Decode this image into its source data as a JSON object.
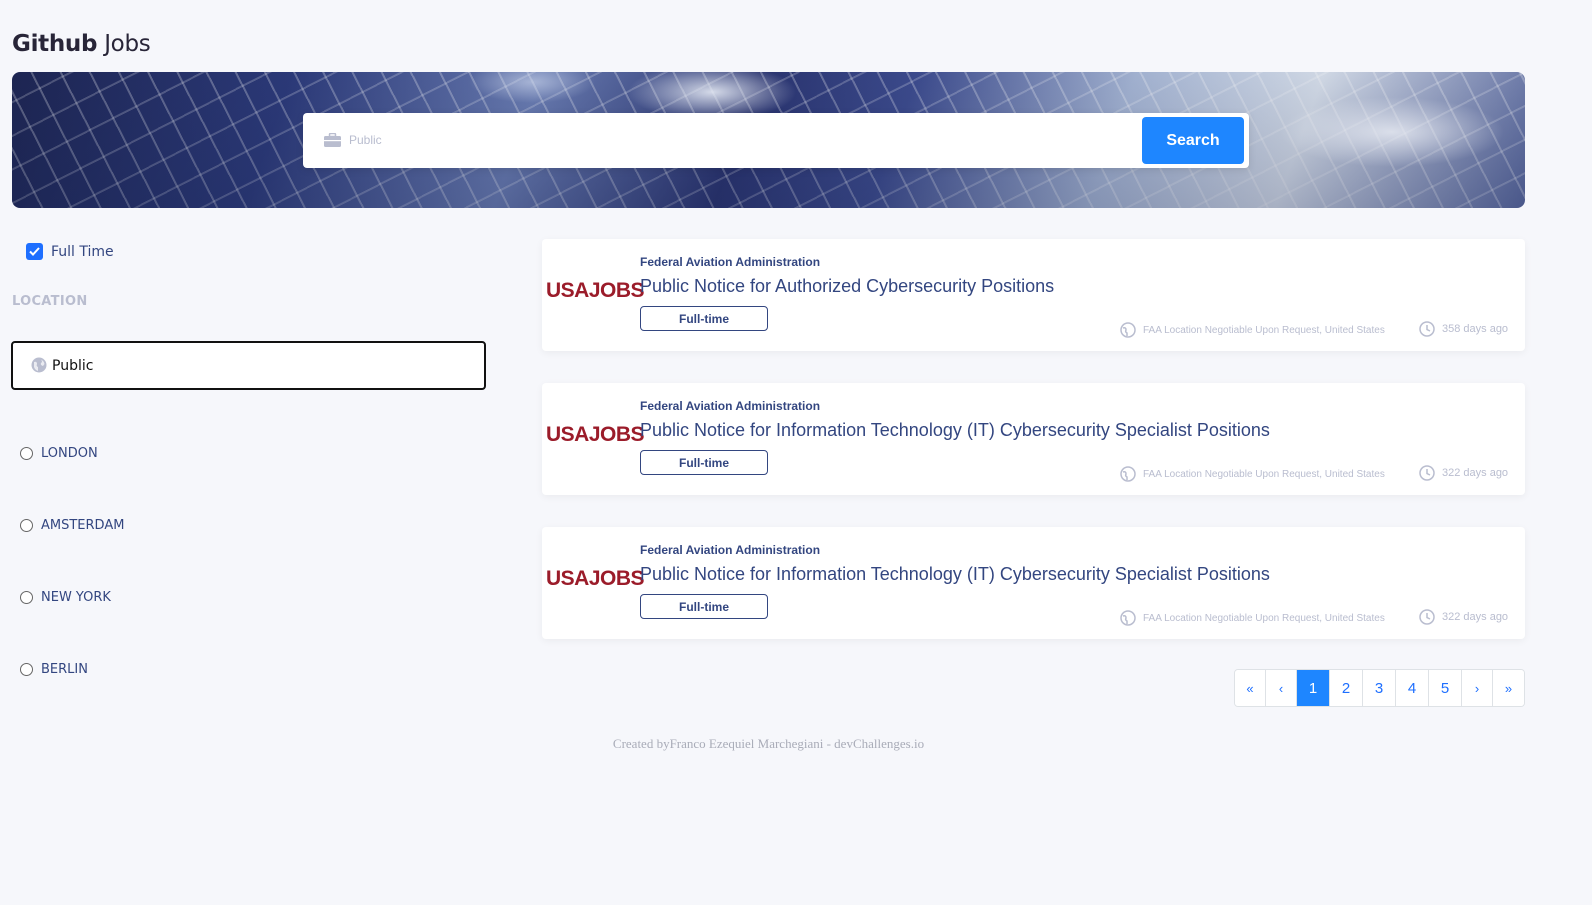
{
  "app": {
    "title_bold": "Github",
    "title_light": "Jobs"
  },
  "search": {
    "placeholder": "Public",
    "value": "",
    "button_label": "Search",
    "icon": "briefcase-icon"
  },
  "filters": {
    "fulltime_label": "Full Time",
    "fulltime_checked": true,
    "location_heading": "LOCATION",
    "location_value": "Public",
    "location_icon": "globe-icon",
    "cities": [
      "LONDON",
      "AMSTERDAM",
      "NEW YORK",
      "BERLIN"
    ]
  },
  "jobs": [
    {
      "logo_text": "USAJOBS",
      "company": "Federal Aviation Administration",
      "title": "Public Notice for Authorized Cybersecurity Positions",
      "type": "Full-time",
      "location": "FAA Location Negotiable Upon Request, United States",
      "posted": "358 days ago"
    },
    {
      "logo_text": "USAJOBS",
      "company": "Federal Aviation Administration",
      "title": "Public Notice for Information Technology (IT) Cybersecurity Specialist Positions",
      "type": "Full-time",
      "location": "FAA Location Negotiable Upon Request, United States",
      "posted": "322 days ago"
    },
    {
      "logo_text": "USAJOBS",
      "company": "Federal Aviation Administration",
      "title": "Public Notice for Information Technology (IT) Cybersecurity Specialist Positions",
      "type": "Full-time",
      "location": "FAA Location Negotiable Upon Request, United States",
      "posted": "322 days ago"
    }
  ],
  "pagination": {
    "first": "«",
    "prev": "‹",
    "next": "›",
    "last": "»",
    "pages": [
      "1",
      "2",
      "3",
      "4",
      "5"
    ],
    "current": "1"
  },
  "footer": {
    "text": "Created byFranco Ezequiel Marchegiani - devChallenges.io"
  },
  "colors": {
    "accent": "#1e86ff",
    "text": "#334680",
    "muted": "#b9bdcf",
    "logo": "#9b1c2a"
  }
}
